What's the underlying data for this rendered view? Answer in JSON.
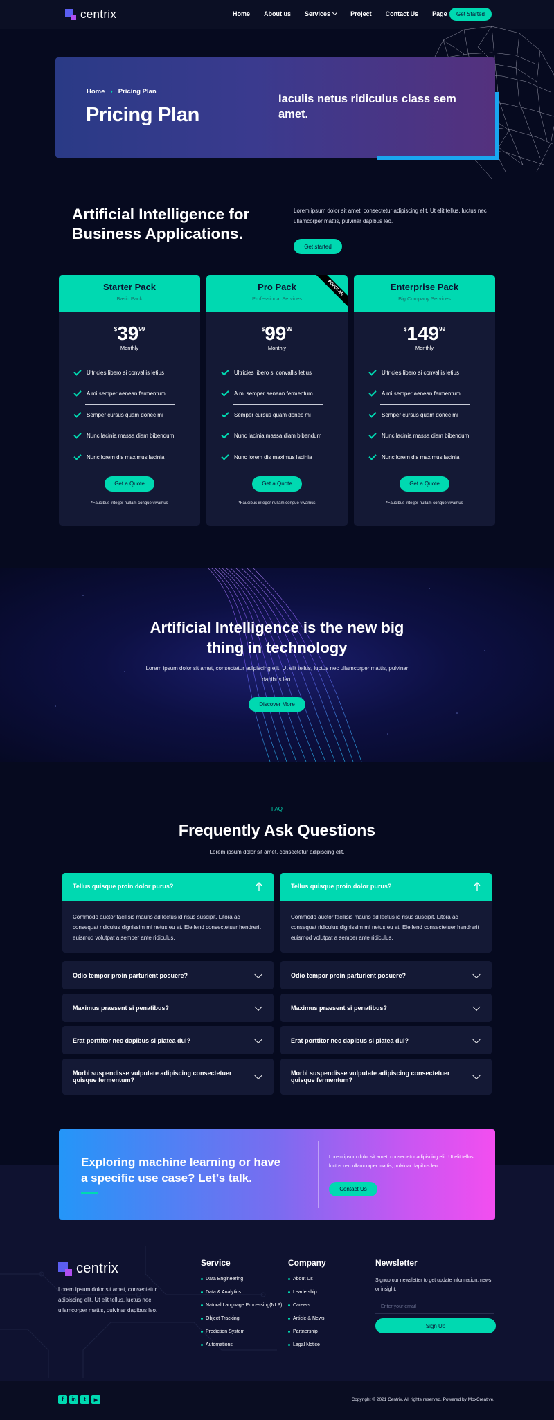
{
  "header": {
    "logo_text": "centrix",
    "nav": [
      {
        "label": "Home",
        "has_dropdown": false
      },
      {
        "label": "About us",
        "has_dropdown": false
      },
      {
        "label": "Services",
        "has_dropdown": true
      },
      {
        "label": "Project",
        "has_dropdown": false
      },
      {
        "label": "Contact Us",
        "has_dropdown": false
      },
      {
        "label": "Page",
        "has_dropdown": true
      }
    ],
    "cta_label": "Get Started"
  },
  "hero": {
    "breadcrumb_home": "Home",
    "breadcrumb_current": "Pricing Plan",
    "title": "Pricing Plan",
    "tagline": "Iaculis netus ridiculus class sem amet."
  },
  "intro": {
    "title": "Artificial Intelligence for Business Applications.",
    "text": "Lorem ipsum dolor sit amet, consectetur adipiscing elit. Ut elit tellus, luctus nec ullamcorper mattis, pulvinar dapibus leo.",
    "button_label": "Get started"
  },
  "plans": [
    {
      "name": "Starter Pack",
      "subtitle": "Basic Pack",
      "currency": "$",
      "amount": "39",
      "cents": "99",
      "period": "Monthly",
      "features": [
        "Ultricies libero si convallis letius",
        "A mi semper aenean fermentum",
        "Semper cursus quam donec mi",
        "Nunc lacinia massa diam bibendum",
        "Nunc lorem dis maximus lacinia"
      ],
      "button_label": "Get a Quote",
      "note": "*Faucibus integer nullam congue vivamus",
      "ribbon": ""
    },
    {
      "name": "Pro Pack",
      "subtitle": "Professional Services",
      "currency": "$",
      "amount": "99",
      "cents": "99",
      "period": "Monthly",
      "features": [
        "Ultricies libero si convallis letius",
        "A mi semper aenean fermentum",
        "Semper cursus quam donec mi",
        "Nunc lacinia massa diam bibendum",
        "Nunc lorem dis maximus lacinia"
      ],
      "button_label": "Get a Quote",
      "note": "*Faucibus integer nullam congue vivamus",
      "ribbon": "POPULAR"
    },
    {
      "name": "Enterprise Pack",
      "subtitle": "Big Company Services",
      "currency": "$",
      "amount": "149",
      "cents": "99",
      "period": "Monthly",
      "features": [
        "Ultricies libero si convallis letius",
        "A mi semper aenean fermentum",
        "Semper cursus quam donec mi",
        "Nunc lacinia massa diam bibendum",
        "Nunc lorem dis maximus lacinia"
      ],
      "button_label": "Get a Quote",
      "note": "*Faucibus integer nullam congue vivamus",
      "ribbon": ""
    }
  ],
  "banner": {
    "title_line1": "Artificial Intelligence is the new big",
    "title_line2": "thing in technology",
    "text": "Lorem ipsum dolor sit amet, consectetur adipiscing elit. Ut elit tellus, luctus nec ullamcorper mattis, pulvinar dapibus leo.",
    "button_label": "Discover More"
  },
  "faq": {
    "kicker": "FAQ",
    "title": "Frequently Ask Questions",
    "subtitle": "Lorem ipsum dolor sit amet, consectetur adipiscing elit.",
    "columns": [
      {
        "open_question": "Tellus quisque proin dolor purus?",
        "open_answer": "Commodo auctor facilisis mauris ad lectus id risus suscipit. Litora ac consequat ridiculus dignissim mi netus eu at. Eleifend consectetuer hendrerit euismod volutpat a semper ante ridiculus.",
        "items": [
          "Odio tempor proin parturient posuere?",
          "Maximus praesent si penatibus?",
          "Erat porttitor nec dapibus si platea dui?",
          "Morbi suspendisse vulputate adipiscing consectetuer quisque fermentum?"
        ]
      },
      {
        "open_question": "Tellus quisque proin dolor purus?",
        "open_answer": "Commodo auctor facilisis mauris ad lectus id risus suscipit. Litora ac consequat ridiculus dignissim mi netus eu at. Eleifend consectetuer hendrerit euismod volutpat a semper ante ridiculus.",
        "items": [
          "Odio tempor proin parturient posuere?",
          "Maximus praesent si penatibus?",
          "Erat porttitor nec dapibus si platea dui?",
          "Morbi suspendisse vulputate adipiscing consectetuer quisque fermentum?"
        ]
      }
    ]
  },
  "cta": {
    "title": "Exploring machine learning or have a specific use case? Let’s talk.",
    "text": "Lorem ipsum dolor sit amet, consectetur adipiscing elit. Ut elit tellus, luctus nec ullamcorper mattis, pulvinar dapibus leo.",
    "button_label": "Contact Us"
  },
  "footer": {
    "logo_text": "centrix",
    "about": "Lorem ipsum dolor sit amet, consectetur adipiscing elit. Ut elit tellus, luctus nec ullamcorper mattis, pulvinar dapibus leo.",
    "service_title": "Service",
    "service_links": [
      "Data Engineering",
      "Data & Analytics",
      "Natural Language Processing(NLP)",
      "Object Tracking",
      "Prediction System",
      "Automations"
    ],
    "company_title": "Company",
    "company_links": [
      "About Us",
      "Leadership",
      "Careers",
      "Article & News",
      "Partnership",
      "Legal Notice"
    ],
    "newsletter_title": "Newsletter",
    "newsletter_text": "Signup our newsletter to get update information, news or insight.",
    "email_placeholder": "Enter your email",
    "signup_label": "Sign Up",
    "socials": [
      {
        "icon": "facebook-icon",
        "glyph": "f"
      },
      {
        "icon": "linkedin-icon",
        "glyph": "in"
      },
      {
        "icon": "twitter-icon",
        "glyph": "t"
      },
      {
        "icon": "youtube-icon",
        "glyph": "▶"
      }
    ],
    "copyright": "Copyright © 2021 Centrix, All rights reserved. Powered by MoxCreative."
  },
  "colors": {
    "background": "#060a1f",
    "accent": "#00d9b1",
    "card": "#141935"
  }
}
